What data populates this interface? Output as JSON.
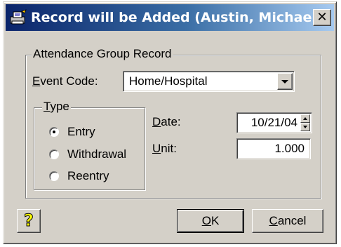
{
  "window": {
    "title": "Record will be Added  (Austin, Michael..."
  },
  "group": {
    "legend": "Attendance Group Record"
  },
  "event_code": {
    "label_mnemonic": "E",
    "label_rest": "vent Code:",
    "value": "Home/Hospital"
  },
  "type_group": {
    "legend_mnemonic": "T",
    "legend_rest": "ype",
    "options": [
      {
        "label": "Entry",
        "checked": true
      },
      {
        "label": "Withdrawal",
        "checked": false
      },
      {
        "label": "Reentry",
        "checked": false
      }
    ]
  },
  "date": {
    "label_mnemonic": "D",
    "label_rest": "ate:",
    "value": "10/21/04"
  },
  "unit": {
    "label_mnemonic": "U",
    "label_rest": "nit:",
    "value": "1.000"
  },
  "buttons": {
    "ok_mnemonic": "O",
    "ok_rest": "K",
    "cancel_mnemonic": "C",
    "cancel_rest": "ancel",
    "help_glyph": "?"
  },
  "colors": {
    "title_gradient_start": "#0a246a",
    "title_gradient_end": "#a6caf0",
    "face": "#d4d0c8",
    "help_yellow": "#ffff00"
  },
  "icons": {
    "app": "printer-dialog-icon",
    "close": "close-icon",
    "dropdown": "chevron-down-icon",
    "help": "question-mark-icon",
    "spin_up": "spin-up-icon",
    "spin_down": "spin-down-icon"
  }
}
